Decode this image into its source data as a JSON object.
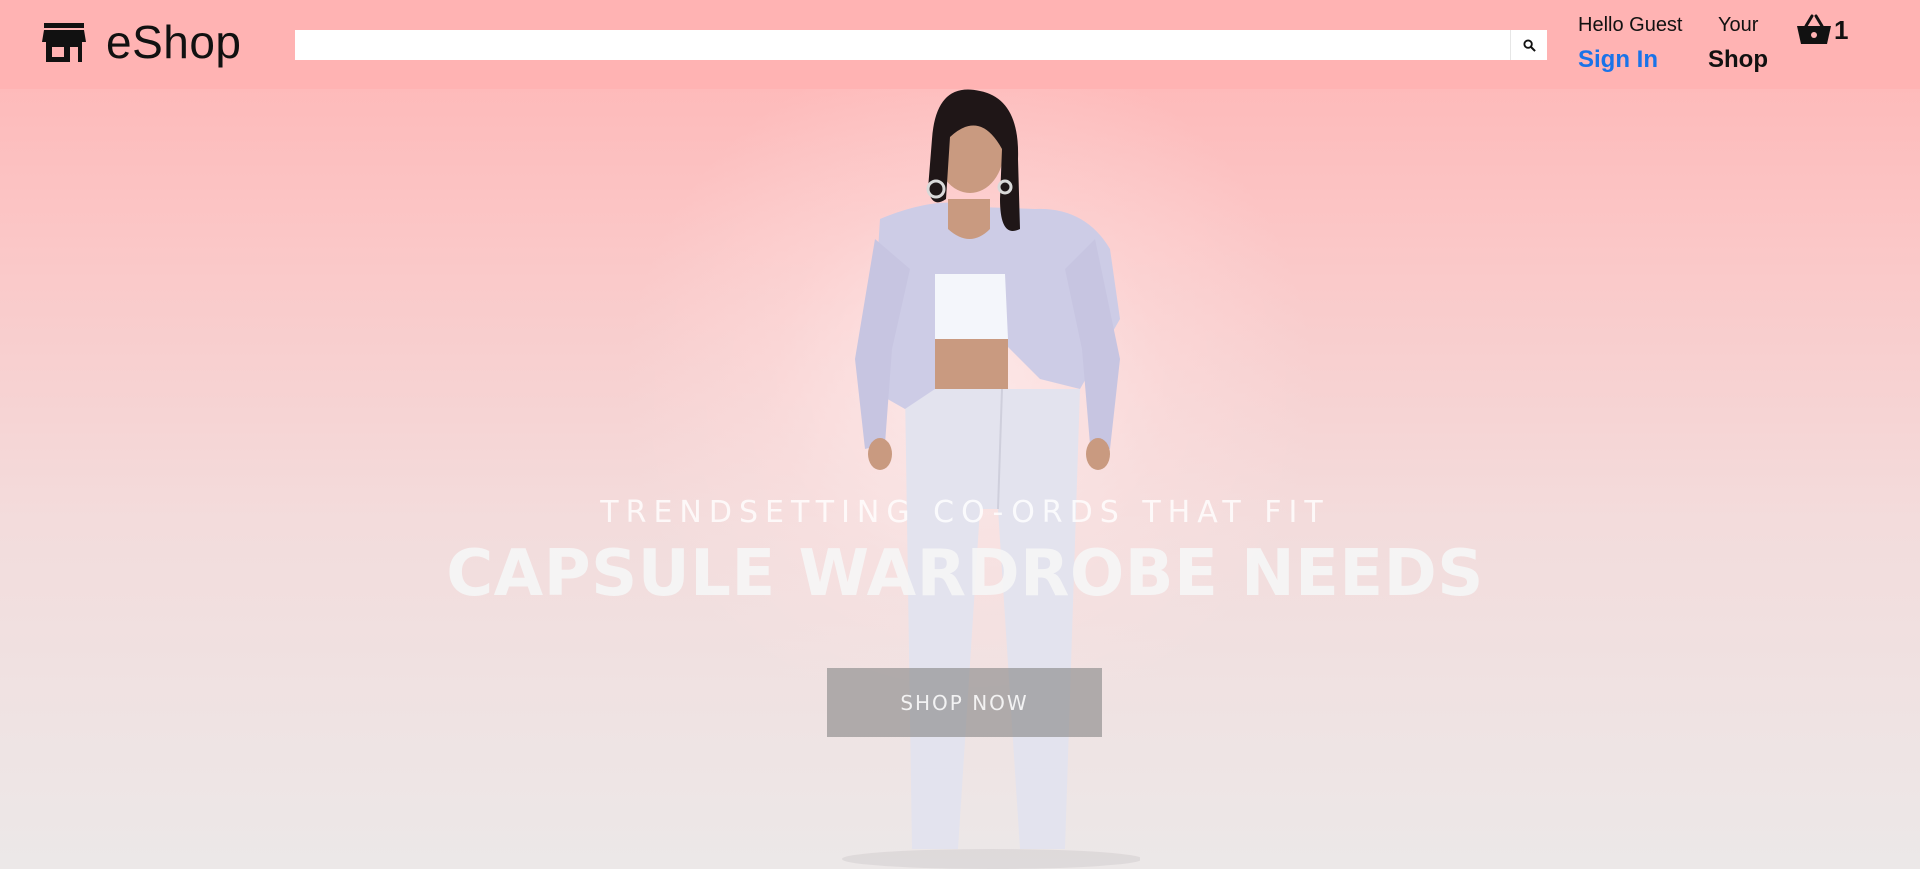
{
  "brand": {
    "name": "eShop",
    "icon": "store-icon"
  },
  "search": {
    "placeholder": "",
    "value": "",
    "button_icon": "search-icon"
  },
  "account": {
    "greeting": "Hello Guest",
    "signin_label": "Sign In"
  },
  "shop_menu": {
    "line1": "Your",
    "line2": "Shop"
  },
  "cart": {
    "icon": "basket-icon",
    "count": "1"
  },
  "hero": {
    "tagline": "TRENDSETTING CO-ORDS THAT FIT",
    "headline": "CAPSULE WARDROBE NEEDS",
    "cta_label": "SHOP NOW"
  },
  "colors": {
    "header_bg": "#ffb3b3",
    "signin": "#1a73e8",
    "cta_bg": "#8c8c8c"
  }
}
